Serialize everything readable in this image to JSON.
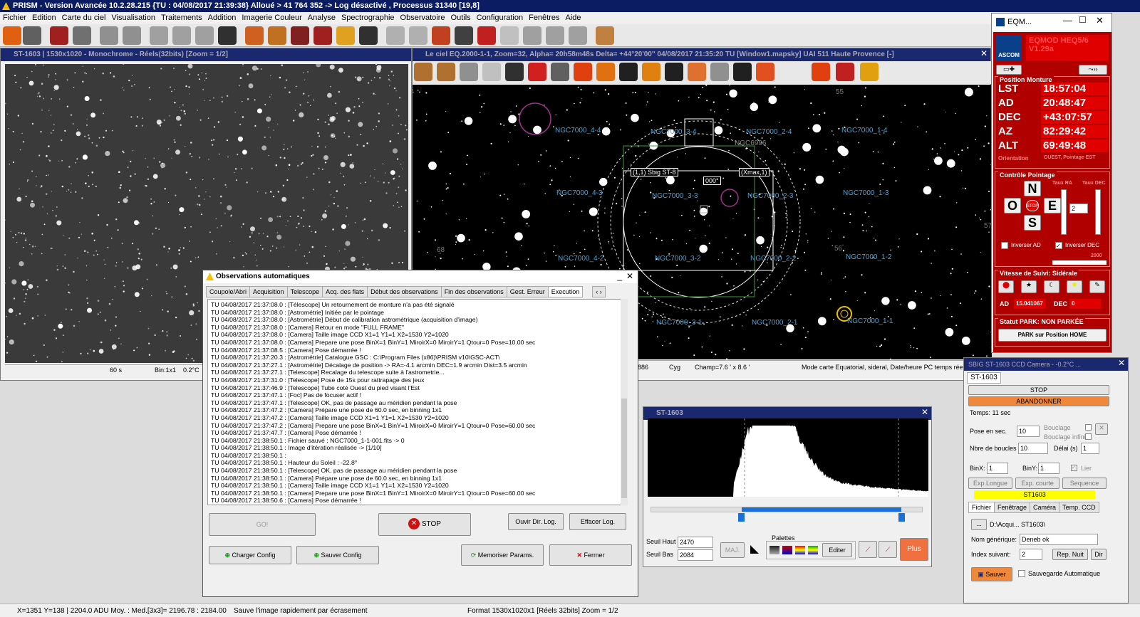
{
  "app": {
    "title": "PRISM - Version Avancée  10.2.28.215   {TU : 04/08/2017 21:39:38} Alloué > 41 764 352 -> Log désactivé , Processus 31340 [19,8]",
    "menu": [
      "Fichier",
      "Edition",
      "Carte du ciel",
      "Visualisation",
      "Traitements",
      "Addition",
      "Imagerie Couleur",
      "Analyse",
      "Spectrographie",
      "Observatoire",
      "Outils",
      "Configuration",
      "Fenêtres",
      "Aide"
    ]
  },
  "image_window": {
    "title": "ST-1603 | 1530x1020 - Monochrome - Réels(32bits)  [Zoom = 1/2]",
    "status": [
      "60 s",
      "Bin:1x1",
      "0.2°C"
    ]
  },
  "sky_window": {
    "title": "Le ciel EQ.2000-1-1, Zoom=32, Alpha= 20h58m48s Delta= +44°20'00''    04/08/2017 21:35:20 TU [Window1.mapsky]  UAI 511 Haute Provence [-]",
    "labels": [
      "NGC7000_4-4",
      "NGC7000_3-4",
      "NGC7000_2-4",
      "NGC7000_1-4",
      "NGC6996",
      "NGC7000_4-3",
      "NGC7000_3-3",
      "NGC7000_2-3",
      "NGC7000_1-3",
      "NGC7000_4-2",
      "NGC7000_3-2",
      "NGC7000_2-2",
      "NGC7000_1-2",
      "NGC7000_3-1",
      "NGC7000_2-1",
      "NGC7000_1-1"
    ],
    "numbers": [
      "55",
      "57",
      "56",
      "68"
    ],
    "frame_label": "(1,1) Sbig ST-8",
    "xmax_label": "(Xmax,1)",
    "angle_label": "000°",
    "status": [
      "886",
      "Cyg",
      "Champ=7.6 ' x 8.6 '",
      "Mode carte Equatorial, sideral, Date/heure PC temps réel"
    ]
  },
  "obs_window": {
    "title": "Observations automatiques",
    "tabs": [
      "Coupole/Abri",
      "Acquisition",
      "Telescope",
      "Acq. des flats",
      "Début des observations",
      "Fin des observations",
      "Gest. Erreur",
      "Execution"
    ],
    "log": [
      "TU 04/08/2017 21:37:08.0 : [Télescope] Un retournement de monture n'a pas été signalé",
      "TU 04/08/2017 21:37:08.0 : [Astrométrie] Initiée par le pointage",
      "TU 04/08/2017 21:37:08.0 : [Astrométrie] Début de calibration astrométrique (acquisition d'image)",
      "TU 04/08/2017 21:37:08.0 : [Camera] Retour en mode \"FULL FRAME\"",
      "TU 04/08/2017 21:37:08.0 : [Camera] Taille image CCD X1=1 Y1=1 X2=1530 Y2=1020",
      "TU 04/08/2017 21:37:08.0 : [Camera] Prepare une pose BinX=1 BinY=1 MiroirX=0 MiroirY=1 Qtour=0 Pose=10.00 sec",
      "TU 04/08/2017 21:37:08.5 : [Camera] Pose démarrée !",
      "TU 04/08/2017 21:37:20.3 : [Astrométrie] Catalogue GSC : C:\\Program Files (x86)\\PRISM v10\\GSC-ACT\\",
      "TU 04/08/2017 21:37:27.1 : [Astrométrie] Décalage de position -> RA=-4.1 arcmin DEC=1.9 arcmin Dist=3.5 arcmin",
      "TU 04/08/2017 21:37:27.1 : [Telescope] Recalage du telescope suite à l'astrometrie...",
      "TU 04/08/2017 21:37:31.0 : [Telescope] Pose de 15s pour rattrapage des jeux",
      "TU 04/08/2017 21:37:46.9 : [Telescope] Tube coté Ouest du pied visant l'Est",
      "TU 04/08/2017 21:37:47.1 : [Foc] Pas de focuser actif !",
      "TU 04/08/2017 21:37:47.1 : [Telescope] OK, pas de passage au méridien pendant la pose",
      "TU 04/08/2017 21:37:47.2 : [Camera] Prépare une pose de 60.0 sec, en binning 1x1",
      "TU 04/08/2017 21:37:47.2 : [Camera] Taille image CCD X1=1 Y1=1 X2=1530 Y2=1020",
      "TU 04/08/2017 21:37:47.2 : [Camera] Prepare une pose BinX=1 BinY=1 MiroirX=0 MiroirY=1 Qtour=0 Pose=60.00 sec",
      "TU 04/08/2017 21:37:47.7 : [Camera] Pose démarrée !",
      "TU 04/08/2017 21:38:50.1 : Fichier sauvé : NGC7000_1-1-001.fits -> 0",
      "TU 04/08/2017 21:38:50.1 : Image d'itération réalisée -> [1/10]",
      "TU 04/08/2017 21:38:50.1 :",
      "TU 04/08/2017 21:38:50.1 : Hauteur du Soleil : -22.8°",
      "TU 04/08/2017 21:38:50.1 : [Telescope] OK, pas de passage au méridien pendant la pose",
      "TU 04/08/2017 21:38:50.1 : [Camera] Prépare une pose de 60.0 sec, en binning 1x1",
      "TU 04/08/2017 21:38:50.1 : [Camera] Taille image CCD X1=1 Y1=1 X2=1530 Y2=1020",
      "TU 04/08/2017 21:38:50.1 : [Camera] Prepare une pose BinX=1 BinY=1 MiroirX=0 MiroirY=1 Qtour=0 Pose=60.00 sec",
      "TU 04/08/2017 21:38:50.6 : [Camera] Pose démarrée !"
    ],
    "buttons": {
      "go": "GO!",
      "stop": "STOP",
      "open_log": "Ouvir Dir. Log.",
      "clear_log": "Effacer Log.",
      "load_config": "Charger Config",
      "save_config": "Sauver Config",
      "memorize": "Memoriser Params.",
      "close": "Fermer"
    }
  },
  "histogram_window": {
    "title": "ST-1603",
    "seuil_haut_label": "Seuil Haut",
    "seuil_haut": "2470",
    "seuil_bas_label": "Seuil Bas",
    "seuil_bas": "2084",
    "maj": "MAJ.",
    "palettes": "Palettes",
    "edit": "Editer",
    "plus": "Plus"
  },
  "eqmod": {
    "title": "EQM...",
    "brand": "EQMOD HEQ5/6",
    "version": "V1.29a",
    "ascom": "ASCOM",
    "position_title": "Position Monture",
    "rows": [
      {
        "label": "LST",
        "value": "18:57:04"
      },
      {
        "label": "AD",
        "value": "20:48:47"
      },
      {
        "label": "DEC",
        "value": "+43:07:57"
      },
      {
        "label": "AZ",
        "value": "82:29:42"
      },
      {
        "label": "ALT",
        "value": "69:49:48"
      }
    ],
    "orientation_label": "Orientation",
    "orientation_value": "OUEST, Pointage EST",
    "control_title": "Contrôle Pointage",
    "taux_ra": "Taux RA",
    "taux_dec": "Taux DEC",
    "rate_value": "2",
    "n": "N",
    "o": "O",
    "e": "E",
    "s": "S",
    "stop": "STOP",
    "invert_ad": "Inverser AD",
    "invert_dec": "Inverser DEC",
    "rate_number": "2000",
    "speed_title": "Vitesse de Suivi: Sidérale",
    "ad_label": "AD",
    "ad_value": "15.041067",
    "dec_label": "DEC",
    "dec_value": "0",
    "park_status": "Statut PARK: NON PARKÉE",
    "park_button": "PARK sur Position HOME"
  },
  "camera": {
    "title": "SBIG ST-1603 CCD Camera  - -0.2°C ...",
    "tab": "ST-1603",
    "stop": "STOP",
    "abort": "ABANDONNER",
    "time": "Temps: 11 sec",
    "exposure_label": "Pose en sec.",
    "exposure_value": "10",
    "loop_label": "Bouclage",
    "loop_inf_label": "Bouclage infini",
    "loops_label": "Nbre de boucles",
    "loops_value": "10",
    "delay_label": "Délai (s)",
    "delay_value": "1",
    "binx_label": "BinX:",
    "binx_value": "1",
    "biny_label": "BinY:",
    "biny_value": "1",
    "link_label": "Lier",
    "exp_long": "Exp.Longue",
    "exp_short": "Exp. courte",
    "sequence": "Sequence",
    "yellow_label": "ST1603",
    "tabs": [
      "Fichier",
      "Fenêtrage",
      "Caméra",
      "Temp. CCD"
    ],
    "path_button": "...",
    "path": "D:\\Acqui... ST1603\\",
    "name_label": "Nom générique:",
    "name_value": "Deneb ok",
    "index_label": "Index suivant:",
    "index_value": "2",
    "rep_nuit": "Rep. Nuit",
    "dir": "Dir",
    "save": "Sauver",
    "auto_save": "Sauvegarde Automatique"
  },
  "statusbar": {
    "coords": "X=1351 Y=138 | 2204.0 ADU   Moy. : Med.[3x3]= 2196.78 : 2184.00",
    "message": "Sauve l'image rapidement par écrasement",
    "format": "Format 1530x1020x1 [Réels 32bits]  Zoom = 1/2"
  },
  "colors": {
    "accent_blue": "#0b1c63",
    "eqmod_red": "#b00000",
    "lcd_red": "#e00000",
    "star_label": "#4fa3d8",
    "abort_orange": "#f0883c",
    "yellow": "#ffff00"
  }
}
